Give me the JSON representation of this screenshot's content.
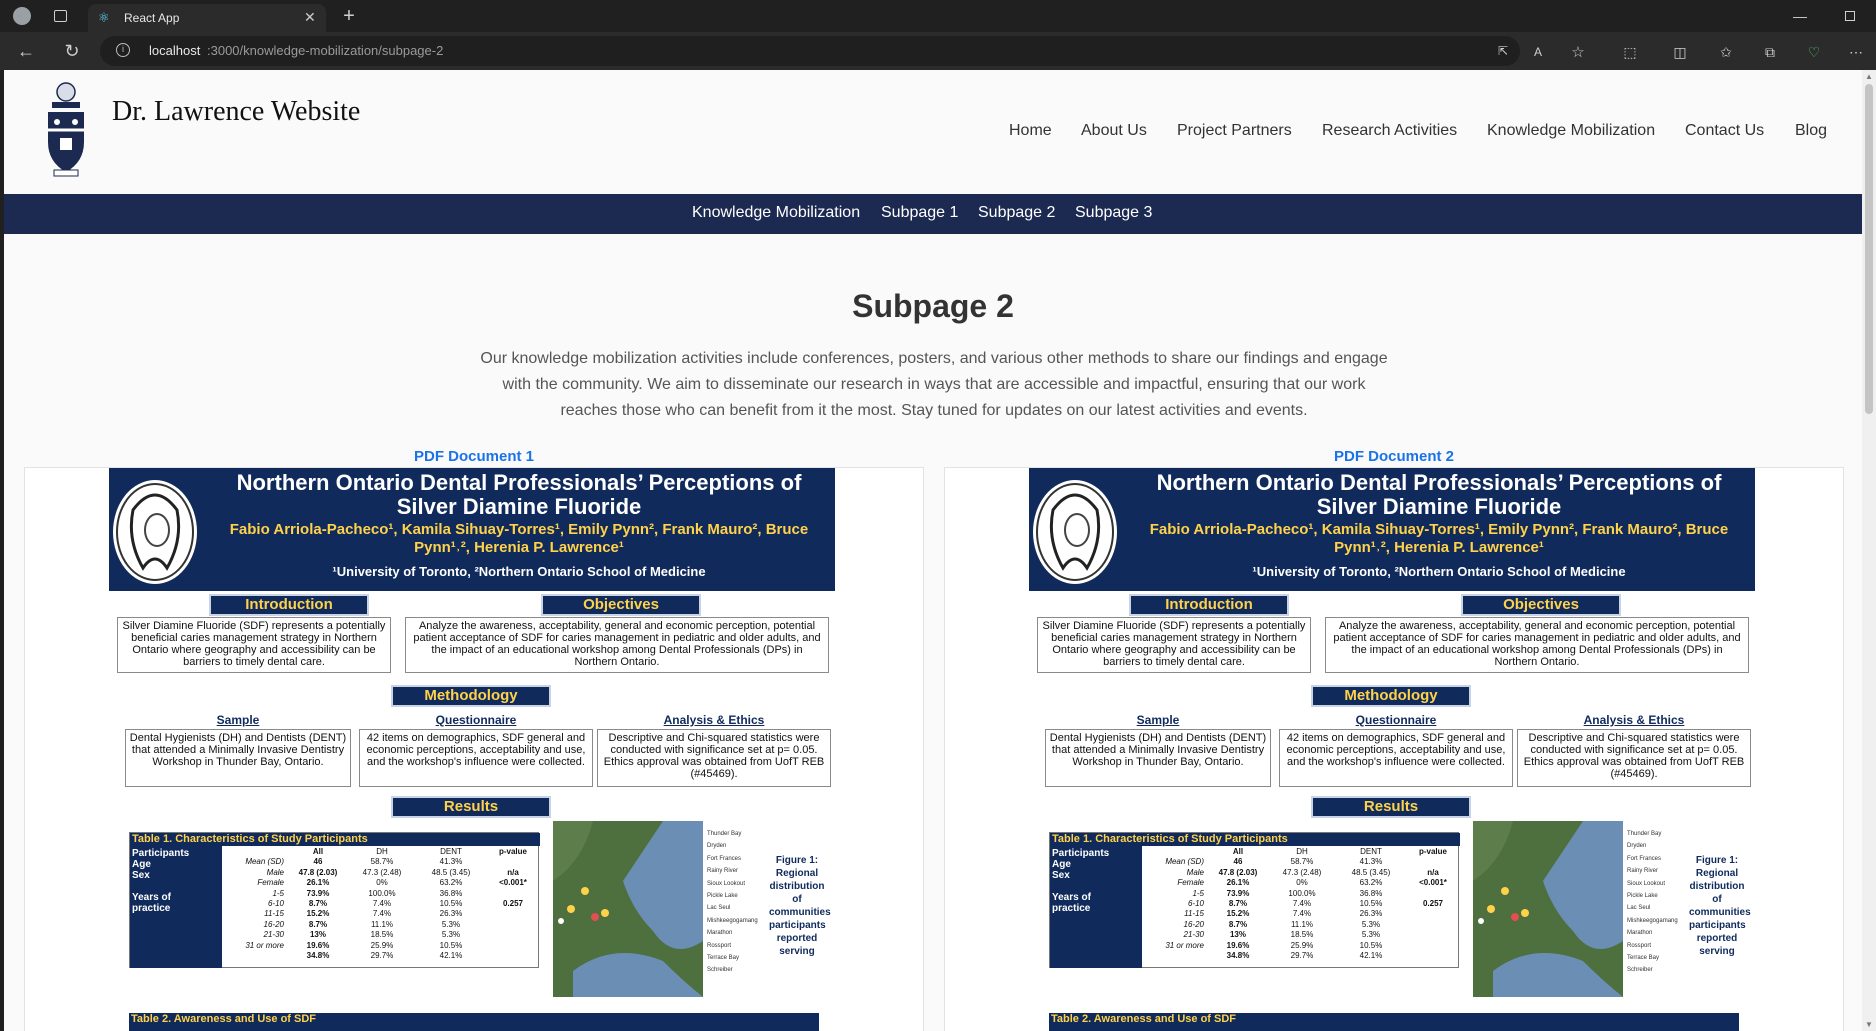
{
  "browser": {
    "tab_title": "React App",
    "url_host": "localhost",
    "url_rest": ":3000/knowledge-mobilization/subpage-2"
  },
  "site": {
    "name": "Dr. Lawrence Website",
    "nav": [
      "Home",
      "About Us",
      "Project Partners",
      "Research Activities",
      "Knowledge Mobilization",
      "Contact Us",
      "Blog"
    ],
    "subnav": [
      "Knowledge Mobilization",
      "Subpage 1",
      "Subpage 2",
      "Subpage 3"
    ]
  },
  "main": {
    "heading": "Subpage 2",
    "intro": "Our knowledge mobilization activities include conferences, posters, and various other methods to share our findings and engage with the community. We aim to disseminate our research in ways that are accessible and impactful, ensuring that our work reaches those who can benefit from it the most. Stay tuned for updates on our latest activities and events.",
    "pdf1_title": "PDF Document 1",
    "pdf2_title": "PDF Document 2"
  },
  "poster": {
    "title": "Northern Ontario Dental Professionals’ Perceptions of Silver Diamine Fluoride",
    "authors": "Fabio Arriola-Pacheco¹, Kamila Sihuay-Torres¹, Emily Pynn², Frank Mauro², Bruce Pynn¹˒², Herenia P. Lawrence¹",
    "affiliations": "¹University of Toronto, ²Northern Ontario School of Medicine",
    "intro_h": "Introduction",
    "intro_t": "Silver Diamine Fluoride (SDF) represents a potentially beneficial caries management strategy in Northern Ontario where geography and accessibility can be barriers to timely dental care.",
    "obj_h": "Objectives",
    "obj_t": "Analyze the awareness, acceptability, general and economic perception, potential patient acceptance of SDF for caries management in pediatric and older adults, and the impact of an educational workshop among Dental Professionals (DPs) in Northern Ontario.",
    "meth_h": "Methodology",
    "sample_h": "Sample",
    "sample_t": "Dental Hygienists (DH) and Dentists (DENT) that attended a Minimally Invasive Dentistry Workshop in Thunder Bay, Ontario.",
    "quest_h": "Questionnaire",
    "quest_t": "42 items on demographics, SDF general and economic perceptions, acceptability and use, and the workshop's influence were collected.",
    "anal_h": "Analysis & Ethics",
    "anal_t": "Descriptive and Chi-squared statistics were conducted with significance set at p= 0.05. Ethics approval was obtained from UofT REB (#45469).",
    "results_h": "Results",
    "table1_title": "Table 1. Characteristics of Study Participants",
    "table1_rows": "Participants\nAge\nSex\n\nYears of\npractice",
    "table1_sub": "\nMean (SD)\nMale\nFemale\n1-5\n6-10\n11-15\n16-20\n21-30\n31 or more",
    "table1_all": "All\n46\n47.8 (2.03)\n26.1%\n73.9%\n8.7%\n15.2%\n8.7%\n13%\n19.6%\n34.8%",
    "table1_dh": "DH\n58.7%\n47.3 (2.48)\n0%\n100.0%\n7.4%\n7.4%\n11.1%\n18.5%\n25.9%\n29.7%",
    "table1_dent": "DENT\n41.3%\n48.5 (3.45)\n63.2%\n36.8%\n10.5%\n26.3%\n5.3%\n5.3%\n10.5%\n42.1%",
    "table1_p": "p-value\n\nn/a\n<0.001*\n\n0.257",
    "map_legend": [
      "Thunder Bay",
      "Dryden",
      "Fort Frances",
      "Rainy River",
      "Sioux Lookout",
      "Pickle Lake",
      "Lac Seul",
      "Mishkeegogamang",
      "Marathon",
      "Rossport",
      "Terrace Bay",
      "Schreiber"
    ],
    "fig_caption": "Figure 1: Regional distribution of communities participants reported serving",
    "table2_title": "Table 2. Awareness and Use of SDF"
  }
}
